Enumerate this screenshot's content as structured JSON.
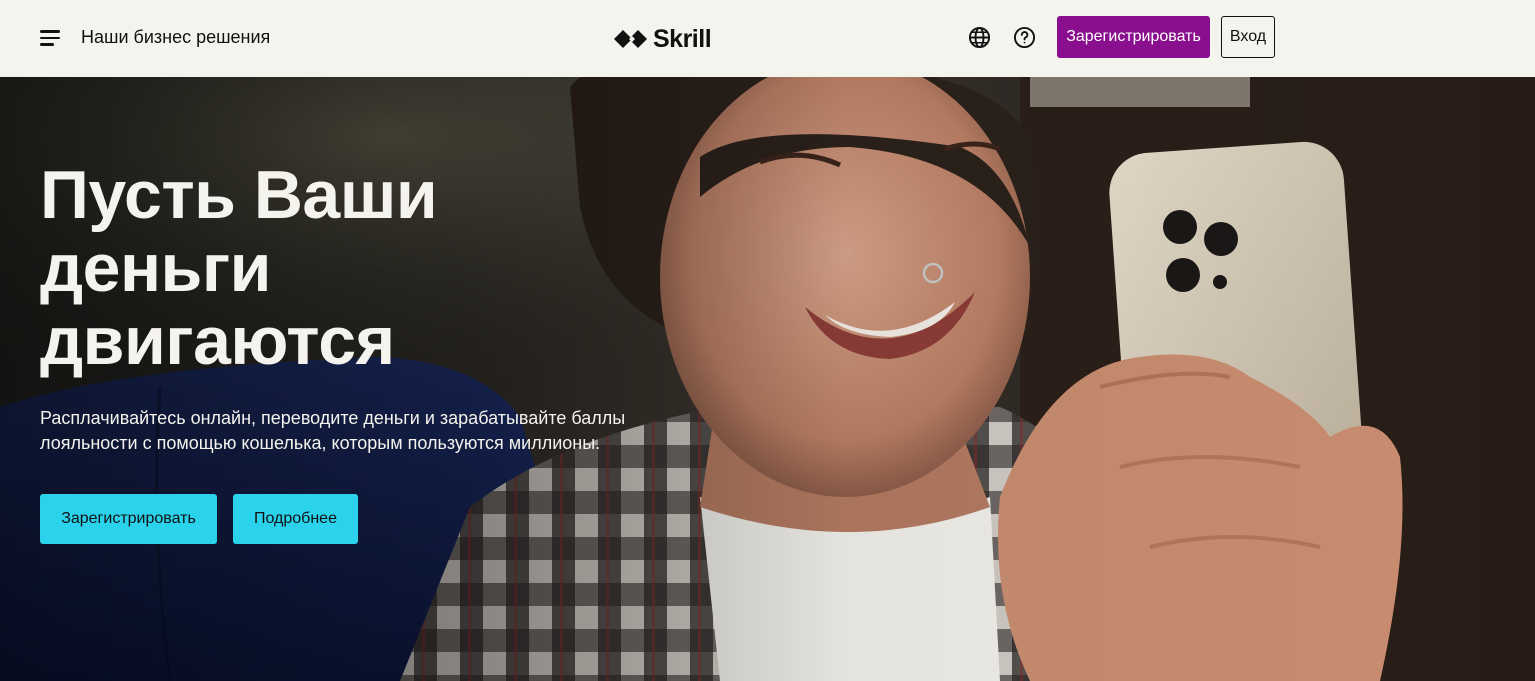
{
  "header": {
    "business_link": "Наши бизнес решения",
    "brand": "Skrill",
    "register_label": "Зарегистрировать",
    "login_label": "Вход"
  },
  "hero": {
    "title_lines": [
      "Пусть Ваши",
      "деньги",
      "двигаются"
    ],
    "subtitle_lines": [
      "Расплачивайтесь онлайн, переводите деньги и зарабатывайте баллы",
      "лояльности с помощью кошелька, которым пользуются миллионы."
    ],
    "register_label": "Зарегистрировать",
    "more_label": "Подробнее"
  },
  "colors": {
    "header_bg": "#f4f4ef",
    "brand_purple": "#8a0f8e",
    "cta_cyan": "#2ad2ec",
    "hero_text": "#f5f3ee"
  },
  "icons": {
    "menu": "hamburger-menu-icon",
    "language": "globe-icon",
    "help": "question-circle-icon",
    "logo": "skrill-diamond-logo"
  }
}
